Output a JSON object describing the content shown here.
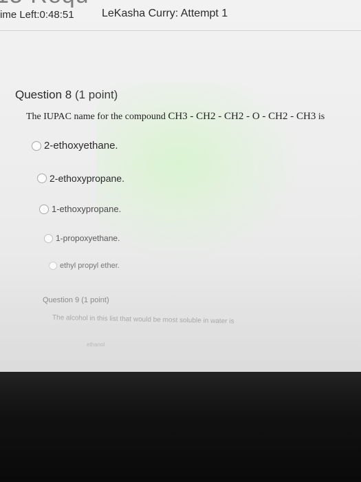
{
  "header": {
    "cut_title": "15 Requ",
    "time_left": "ime Left:0:48:51",
    "student_attempt": "LeKasha Curry: Attempt 1"
  },
  "question8": {
    "title": "Question 8",
    "points": "(1 point)",
    "text_prefix": "The IUPAC name for the compound",
    "formula": "CH3 - CH2 - CH2 - O - CH2 - CH3",
    "text_suffix": "is",
    "options": [
      "2-ethoxyethane.",
      "2-ethoxypropane.",
      "1-ethoxypropane.",
      "1-propoxyethane.",
      "ethyl propyl ether."
    ]
  },
  "question9": {
    "title": "Question 9",
    "points": "(1 point)",
    "text": "The alcohol in this list that would be most soluble in water is",
    "first_option": "ethanol"
  }
}
